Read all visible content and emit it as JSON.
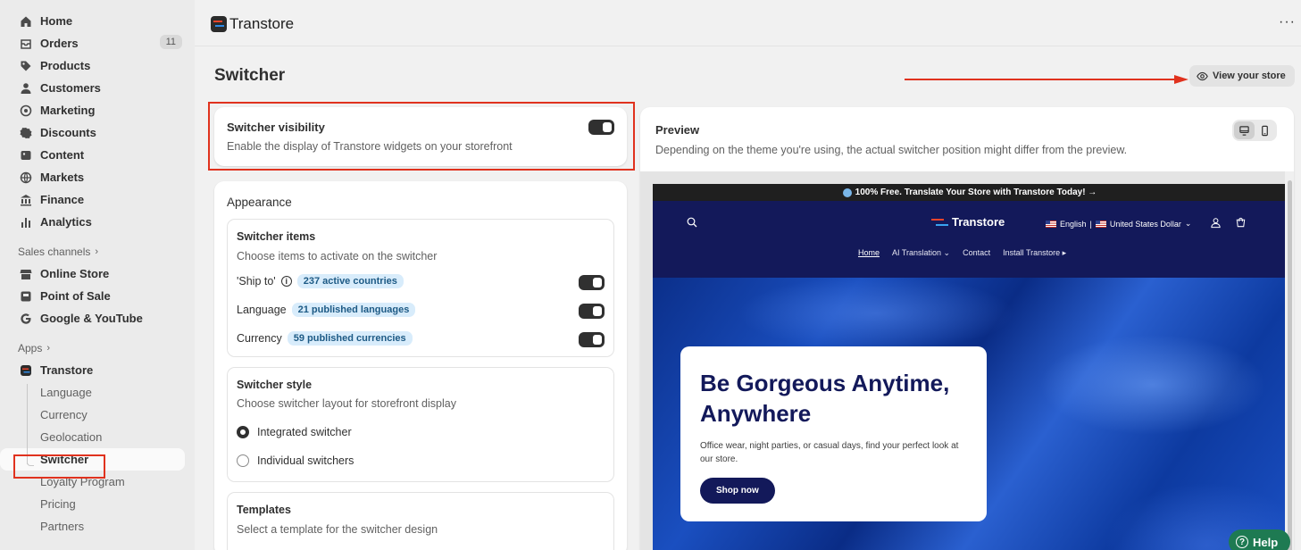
{
  "sidebar": {
    "main_items": [
      {
        "label": "Home",
        "icon": "home-icon"
      },
      {
        "label": "Orders",
        "icon": "orders-icon",
        "badge": "11"
      },
      {
        "label": "Products",
        "icon": "tag-icon"
      },
      {
        "label": "Customers",
        "icon": "person-icon"
      },
      {
        "label": "Marketing",
        "icon": "target-icon"
      },
      {
        "label": "Discounts",
        "icon": "discount-icon"
      },
      {
        "label": "Content",
        "icon": "content-icon"
      },
      {
        "label": "Markets",
        "icon": "globe-icon"
      },
      {
        "label": "Finance",
        "icon": "bank-icon"
      },
      {
        "label": "Analytics",
        "icon": "bar-chart-icon"
      }
    ],
    "sales_channels_label": "Sales channels",
    "sales_channels": [
      {
        "label": "Online Store",
        "icon": "store-icon"
      },
      {
        "label": "Point of Sale",
        "icon": "pos-icon"
      },
      {
        "label": "Google & YouTube",
        "icon": "google-icon"
      }
    ],
    "apps_label": "Apps",
    "app_name": "Transtore",
    "app_sub_items": [
      "Language",
      "Currency",
      "Geolocation",
      "Switcher",
      "Loyalty Program",
      "Pricing",
      "Partners"
    ],
    "active_sub_item": "Switcher"
  },
  "topbar": {
    "app_title": "Transtore",
    "more": "···"
  },
  "page": {
    "title": "Switcher",
    "view_store_label": "View your store"
  },
  "visibility": {
    "title": "Switcher visibility",
    "description": "Enable the display of Transtore widgets on your storefront",
    "enabled": true
  },
  "appearance": {
    "title": "Appearance",
    "items_section": {
      "title": "Switcher items",
      "description": "Choose items to activate on the switcher",
      "items": [
        {
          "label": "'Ship to'",
          "chip": "237 active countries",
          "has_info": true,
          "enabled": true
        },
        {
          "label": "Language",
          "chip": "21 published languages",
          "has_info": false,
          "enabled": true
        },
        {
          "label": "Currency",
          "chip": "59 published currencies",
          "has_info": false,
          "enabled": true
        }
      ]
    },
    "style_section": {
      "title": "Switcher style",
      "description": "Choose switcher layout for storefront display",
      "options": [
        "Integrated switcher",
        "Individual switchers"
      ],
      "selected": "Integrated switcher"
    },
    "templates_section": {
      "title": "Templates",
      "description": "Select a template for the switcher design"
    }
  },
  "preview": {
    "title": "Preview",
    "description": "Depending on the theme you're using, the actual switcher position might differ from the preview.",
    "device_selected": "desktop",
    "store": {
      "announcement": "100% Free. Translate Your Store with Transtore Today! →",
      "logo": "Transtore",
      "language": "English",
      "currency": "United States Dollar",
      "nav": [
        "Home",
        "AI Translation",
        "Contact",
        "Install Transtore"
      ],
      "hero_title": "Be Gorgeous Anytime, Anywhere",
      "hero_subtitle": "Office wear, night parties, or casual days, find your perfect look at our store.",
      "hero_button": "Shop now"
    }
  },
  "help_label": "Help",
  "colors": {
    "annotation_red": "#e0321e",
    "store_navy": "#13195a",
    "chip_bg": "#d8ecfb",
    "help_green": "#1e7a52"
  }
}
